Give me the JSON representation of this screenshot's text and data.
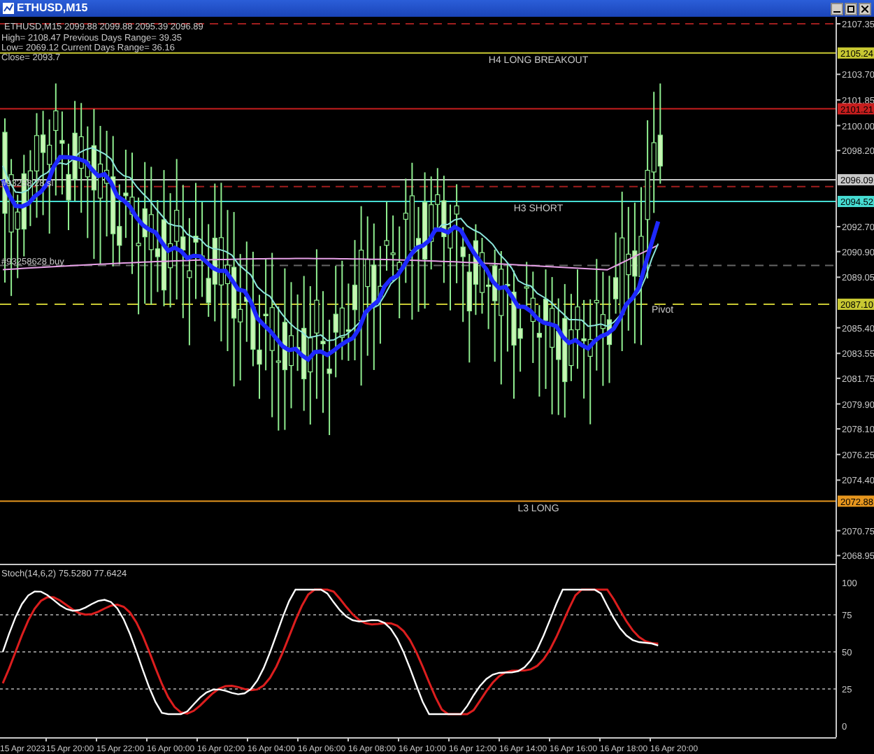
{
  "window": {
    "title": "ETHUSD,M15"
  },
  "header": {
    "quote": "ETHUSD,M15  2099.88 2099.88 2095.39 2096.89",
    "lines": [
      "High= 2108.47   Previous Days Range= 39.35",
      "Low= 2069.12   Current Days Range= 36.16",
      "Close= 2093.7"
    ]
  },
  "levels": [
    {
      "kind": "solid",
      "price": "2105.24",
      "label": "H4 LONG BREAKOUT",
      "color": "#c8c832"
    },
    {
      "kind": "solid",
      "price": "2101.21",
      "color": "#c81e1e"
    },
    {
      "kind": "solid",
      "price": "2096.09",
      "color": "#c8c8c8"
    },
    {
      "kind": "solid",
      "price": "2094.52",
      "label": "H3 SHORT",
      "color": "#46dcd2"
    },
    {
      "kind": "dashed",
      "price": "2087.10",
      "label": "Pivot",
      "color": "#c8c832"
    },
    {
      "kind": "solid",
      "price": "2072.88",
      "label": "L3 LONG",
      "color": "#e6961e"
    }
  ],
  "orders": [
    {
      "label": "#93258 28 sl"
    },
    {
      "label": "#93258628 buy"
    }
  ],
  "price_axis": [
    "2107.35",
    "2103.70",
    "2101.85",
    "2100.00",
    "2098.20",
    "2092.70",
    "2090.90",
    "2089.05",
    "2085.40",
    "2083.55",
    "2081.75",
    "2079.90",
    "2078.10",
    "2076.25",
    "2074.40",
    "2070.75",
    "2068.95"
  ],
  "stochastic": {
    "label": "Stoch(14,6,2) 75.5280 77.6424",
    "axis": [
      "100",
      "75",
      "50",
      "25",
      "0"
    ]
  },
  "time_axis": [
    "15 Apr 2023",
    "15 Apr 20:00",
    "15 Apr 22:00",
    "16 Apr 00:00",
    "16 Apr 02:00",
    "16 Apr 04:00",
    "16 Apr 06:00",
    "16 Apr 08:00",
    "16 Apr 10:00",
    "16 Apr 12:00",
    "16 Apr 14:00",
    "16 Apr 16:00",
    "16 Apr 18:00",
    "16 Apr 20:00"
  ]
}
